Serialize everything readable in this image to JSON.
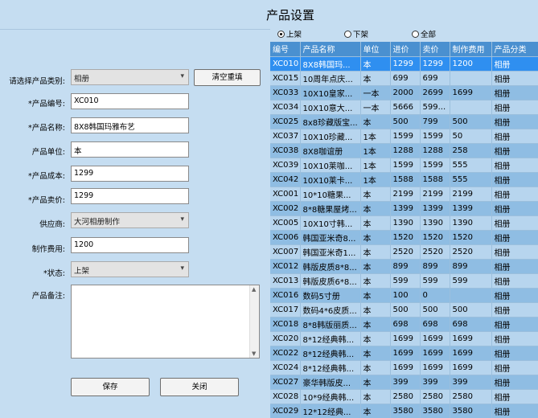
{
  "window": {
    "title": "产品设置"
  },
  "form": {
    "category_label": "请选择产品类别:",
    "category_value": "相册",
    "clear_button": "清空重填",
    "code_label": "*产品编号:",
    "code_value": "XC010",
    "name_label": "*产品名称:",
    "name_value": "8X8韩国玛雅布艺",
    "unit_label": "产品单位:",
    "unit_value": "本",
    "cost_label": "*产品成本:",
    "cost_value": "1299",
    "price_label": "*产品卖价:",
    "price_value": "1299",
    "supplier_label": "供应商:",
    "supplier_value": "大河相册制作",
    "fee_label": "制作费用:",
    "fee_value": "1200",
    "status_label": "*状态:",
    "status_value": "上架",
    "remark_label": "产品备注:",
    "save_button": "保存",
    "close_button": "关闭"
  },
  "filter": {
    "options": [
      {
        "label": "上架",
        "checked": true
      },
      {
        "label": "下架",
        "checked": false
      },
      {
        "label": "全部",
        "checked": false
      }
    ]
  },
  "table": {
    "columns": [
      "编号",
      "产品名称",
      "单位",
      "进价",
      "卖价",
      "制作费用",
      "产品分类"
    ],
    "rows": [
      [
        "XC010",
        "8X8韩国玛...",
        "本",
        "1299",
        "1299",
        "1200",
        "相册"
      ],
      [
        "XC015",
        "10周年点庆...",
        "本",
        "699",
        "699",
        "",
        "相册"
      ],
      [
        "XC033",
        "10X10皇家...",
        "一本",
        "2000",
        "2699",
        "1699",
        "相册"
      ],
      [
        "XC034",
        "10X10意大...",
        "一本",
        "5666",
        "599...",
        "",
        "相册"
      ],
      [
        "XC025",
        "8x8珍藏版宝...",
        "本",
        "500",
        "799",
        "500",
        "相册"
      ],
      [
        "XC037",
        "10X10珍藏...",
        "1本",
        "1599",
        "1599",
        "50",
        "相册"
      ],
      [
        "XC038",
        "8X8咖谊册",
        "1本",
        "1288",
        "1288",
        "258",
        "相册"
      ],
      [
        "XC039",
        "10X10莱咖...",
        "1本",
        "1599",
        "1599",
        "555",
        "相册"
      ],
      [
        "XC042",
        "10X10莱卡...",
        "1本",
        "1588",
        "1588",
        "555",
        "相册"
      ],
      [
        "XC001",
        "10*10糖果...",
        "本",
        "2199",
        "2199",
        "2199",
        "相册"
      ],
      [
        "XC002",
        "8*8糖果屋烤...",
        "本",
        "1399",
        "1399",
        "1399",
        "相册"
      ],
      [
        "XC005",
        "10X10寸韩...",
        "本",
        "1390",
        "1390",
        "1390",
        "相册"
      ],
      [
        "XC006",
        "韩国亚米奇8...",
        "本",
        "1520",
        "1520",
        "1520",
        "相册"
      ],
      [
        "XC007",
        "韩国亚米奇1...",
        "本",
        "2520",
        "2520",
        "2520",
        "相册"
      ],
      [
        "XC012",
        "韩版皮质8*8...",
        "本",
        "899",
        "899",
        "899",
        "相册"
      ],
      [
        "XC013",
        "韩版皮质6*8...",
        "本",
        "599",
        "599",
        "599",
        "相册"
      ],
      [
        "XC016",
        "数码5寸册",
        "本",
        "100",
        "0",
        "",
        "相册"
      ],
      [
        "XC017",
        "数码4*6皮质...",
        "本",
        "500",
        "500",
        "500",
        "相册"
      ],
      [
        "XC018",
        "8*8韩版丽质...",
        "本",
        "698",
        "698",
        "698",
        "相册"
      ],
      [
        "XC020",
        "8*12经典韩...",
        "本",
        "1699",
        "1699",
        "1699",
        "相册"
      ],
      [
        "XC022",
        "8*12经典韩...",
        "本",
        "1699",
        "1699",
        "1699",
        "相册"
      ],
      [
        "XC024",
        "8*12经典韩...",
        "本",
        "1699",
        "1699",
        "1699",
        "相册"
      ],
      [
        "XC027",
        "豪华韩版皮...",
        "本",
        "399",
        "399",
        "399",
        "相册"
      ],
      [
        "XC028",
        "10*9经典韩...",
        "本",
        "2580",
        "2580",
        "2580",
        "相册"
      ],
      [
        "XC029",
        "12*12经典...",
        "本",
        "3580",
        "3580",
        "3580",
        "相册"
      ]
    ]
  }
}
